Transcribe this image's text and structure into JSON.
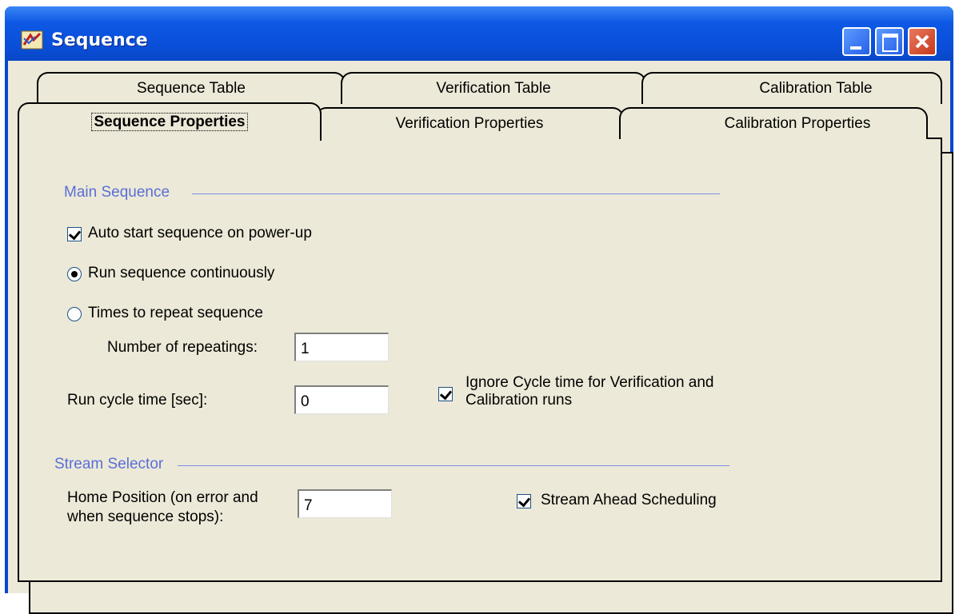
{
  "window": {
    "title": "Sequence",
    "app_icon": "sequence-app-icon"
  },
  "titlebar_buttons": [
    "minimize",
    "maximize",
    "close"
  ],
  "tabs_back_row": [
    {
      "label": "Sequence Table"
    },
    {
      "label": "Verification Table"
    },
    {
      "label": "Calibration Table"
    }
  ],
  "tabs_front_row": [
    {
      "label": "Sequence Properties",
      "active": true
    },
    {
      "label": "Verification Properties"
    },
    {
      "label": "Calibration Properties"
    }
  ],
  "main_sequence": {
    "group_label": "Main Sequence",
    "auto_start": {
      "label": "Auto start sequence on power-up",
      "checked": true
    },
    "run_continuously": {
      "label": "Run sequence continuously",
      "selected": true
    },
    "times_to_repeat": {
      "label": "Times to repeat sequence",
      "selected": false
    },
    "repeatings": {
      "label": "Number of repeatings:",
      "value": "1"
    },
    "cycle_time": {
      "label": "Run cycle time [sec]:",
      "value": "0"
    },
    "ignore_cycle": {
      "label_line1": "Ignore Cycle time for Verification and",
      "label_line2": "Calibration runs",
      "checked": true
    }
  },
  "stream_selector": {
    "group_label": "Stream Selector",
    "home_position": {
      "label_line1": "Home Position (on error and",
      "label_line2": "when sequence stops):",
      "value": "7"
    },
    "stream_ahead": {
      "label": "Stream Ahead Scheduling",
      "checked": true
    }
  }
}
